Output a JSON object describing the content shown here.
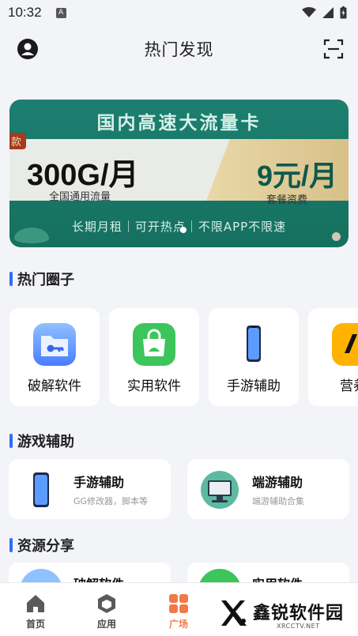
{
  "status_bar": {
    "time": "10:32",
    "notification_glyph": "A"
  },
  "header": {
    "title": "热门发现"
  },
  "banner": {
    "headline": "国内高速大流量卡",
    "tag": "款",
    "data_amount": "300G/月",
    "data_sub": "全国通用流量",
    "price": "9元/月",
    "price_sub": "套餐资费",
    "footer": "长期月租｜可开热点｜不限APP不限速"
  },
  "sections": {
    "hot_circles": "热门圈子",
    "game_assist": "游戏辅助",
    "resources": "资源分享"
  },
  "categories": [
    {
      "label": "破解软件",
      "icon": "folder-key-icon"
    },
    {
      "label": "实用软件",
      "icon": "shopping-bag-icon"
    },
    {
      "label": "手游辅助",
      "icon": "phone-icon"
    },
    {
      "label": "营养",
      "icon": "app-icon"
    }
  ],
  "game_cards": [
    {
      "name": "手游辅助",
      "desc": "GG修改器，脚本等"
    },
    {
      "name": "端游辅助",
      "desc": "端游辅助合集"
    }
  ],
  "resource_cards": [
    {
      "name": "破解软件"
    },
    {
      "name": "实用软件"
    }
  ],
  "tabs": [
    {
      "label": "首页",
      "icon": "home-icon"
    },
    {
      "label": "应用",
      "icon": "cube-icon"
    },
    {
      "label": "广场",
      "icon": "grid-icon"
    }
  ],
  "watermark": {
    "text": "鑫锐软件园",
    "url": "XRCCTV.NET"
  },
  "colors": {
    "accent": "#2f6bff",
    "active_tab": "#f07a4a",
    "banner_green": "#1c7f70"
  }
}
